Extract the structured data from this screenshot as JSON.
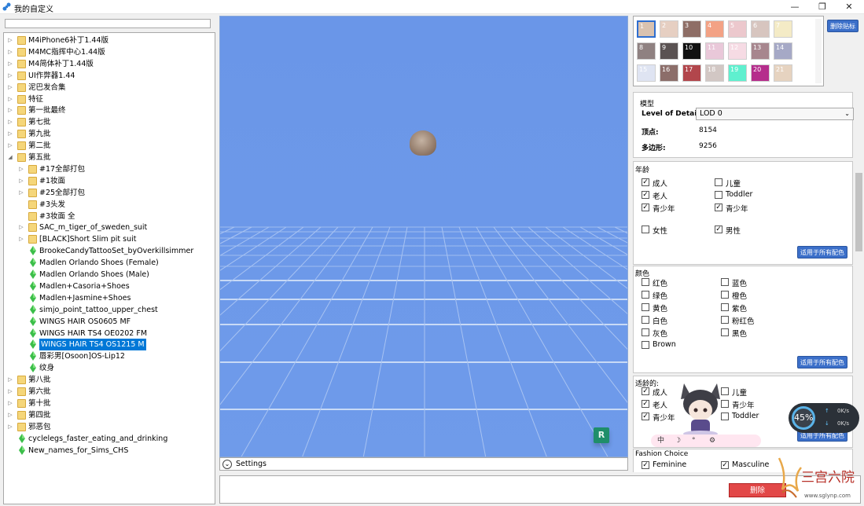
{
  "window": {
    "title": "我的自定义",
    "minimize": "—",
    "restore": "❐",
    "close": "✕"
  },
  "tree": {
    "items": [
      {
        "label": "M4iPhone6补丁1.44版",
        "kind": "folder",
        "level": 0,
        "expanded": false,
        "selected": false
      },
      {
        "label": "M4MC指挥中心1.44版",
        "kind": "folder",
        "level": 0,
        "expanded": false,
        "selected": false
      },
      {
        "label": "M4简体补丁1.44版",
        "kind": "folder",
        "level": 0,
        "expanded": false,
        "selected": false
      },
      {
        "label": "UI作弊器1.44",
        "kind": "folder",
        "level": 0,
        "expanded": false,
        "selected": false
      },
      {
        "label": "泥巴发合集",
        "kind": "folder",
        "level": 0,
        "expanded": false,
        "selected": false
      },
      {
        "label": "特征",
        "kind": "folder",
        "level": 0,
        "expanded": false,
        "selected": false
      },
      {
        "label": "第一批最终",
        "kind": "folder",
        "level": 0,
        "expanded": false,
        "selected": false
      },
      {
        "label": "第七批",
        "kind": "folder",
        "level": 0,
        "expanded": false,
        "selected": false
      },
      {
        "label": "第九批",
        "kind": "folder",
        "level": 0,
        "expanded": false,
        "selected": false
      },
      {
        "label": "第二批",
        "kind": "folder",
        "level": 0,
        "expanded": false,
        "selected": false
      },
      {
        "label": "第五批",
        "kind": "folder",
        "level": 0,
        "expanded": true,
        "selected": false
      },
      {
        "label": "#17全部打包",
        "kind": "folder",
        "level": 1,
        "expanded": false,
        "selected": false
      },
      {
        "label": "#1妆面",
        "kind": "folder",
        "level": 1,
        "expanded": false,
        "selected": false
      },
      {
        "label": "#25全部打包",
        "kind": "folder",
        "level": 1,
        "expanded": false,
        "selected": false
      },
      {
        "label": "#3头发",
        "kind": "folder",
        "level": 1,
        "expanded": null,
        "selected": false
      },
      {
        "label": "#3妆面 全",
        "kind": "folder",
        "level": 1,
        "expanded": null,
        "selected": false
      },
      {
        "label": "SAC_m_tiger_of_sweden_suit",
        "kind": "folder",
        "level": 1,
        "expanded": false,
        "selected": false
      },
      {
        "label": "[BLACK]Short Slim pit suit",
        "kind": "folder",
        "level": 1,
        "expanded": false,
        "selected": false
      },
      {
        "label": "BrookeCandyTattooSet_byOverkillsimmer",
        "kind": "item",
        "level": 1,
        "expanded": null,
        "selected": false
      },
      {
        "label": "Madlen Orlando Shoes (Female)",
        "kind": "item",
        "level": 1,
        "expanded": null,
        "selected": false
      },
      {
        "label": "Madlen Orlando Shoes (Male)",
        "kind": "item",
        "level": 1,
        "expanded": null,
        "selected": false
      },
      {
        "label": "Madlen+Casoria+Shoes",
        "kind": "item",
        "level": 1,
        "expanded": null,
        "selected": false
      },
      {
        "label": "Madlen+Jasmine+Shoes",
        "kind": "item",
        "level": 1,
        "expanded": null,
        "selected": false
      },
      {
        "label": "simjo_point_tattoo_upper_chest",
        "kind": "item",
        "level": 1,
        "expanded": null,
        "selected": false
      },
      {
        "label": "WINGS HAIR OS0605 MF",
        "kind": "item",
        "level": 1,
        "expanded": null,
        "selected": false
      },
      {
        "label": "WINGS HAIR TS4 OE0202 FM",
        "kind": "item",
        "level": 1,
        "expanded": null,
        "selected": false
      },
      {
        "label": "WINGS HAIR TS4 OS1215 M",
        "kind": "item",
        "level": 1,
        "expanded": null,
        "selected": true
      },
      {
        "label": "唇彩男[Osoon]OS-Lip12",
        "kind": "item",
        "level": 1,
        "expanded": null,
        "selected": false
      },
      {
        "label": "纹身",
        "kind": "item",
        "level": 1,
        "expanded": null,
        "selected": false
      },
      {
        "label": "第八批",
        "kind": "folder",
        "level": 0,
        "expanded": false,
        "selected": false
      },
      {
        "label": "第六批",
        "kind": "folder",
        "level": 0,
        "expanded": false,
        "selected": false
      },
      {
        "label": "第十批",
        "kind": "folder",
        "level": 0,
        "expanded": false,
        "selected": false
      },
      {
        "label": "第四批",
        "kind": "folder",
        "level": 0,
        "expanded": false,
        "selected": false
      },
      {
        "label": "邪恶包",
        "kind": "folder",
        "level": 0,
        "expanded": false,
        "selected": false
      },
      {
        "label": "cyclelegs_faster_eating_and_drinking",
        "kind": "item",
        "level": 0,
        "expanded": null,
        "selected": false
      },
      {
        "label": "New_names_for_Sims_CHS",
        "kind": "item",
        "level": 0,
        "expanded": null,
        "selected": false
      }
    ]
  },
  "viewport": {
    "settings_label": "Settings",
    "badge": "R"
  },
  "swatches": {
    "delete_label": "删除贴标",
    "items": [
      {
        "num": "1",
        "color": "#d9c2b0",
        "selected": true
      },
      {
        "num": "2",
        "color": "#e6cfc2",
        "selected": false
      },
      {
        "num": "3",
        "color": "#8e6e66",
        "selected": false
      },
      {
        "num": "4",
        "color": "#f3a285",
        "selected": false
      },
      {
        "num": "5",
        "color": "#ecc8cd",
        "selected": false
      },
      {
        "num": "6",
        "color": "#d7c5bf",
        "selected": false
      },
      {
        "num": "7",
        "color": "#f4ebc6",
        "selected": false
      },
      {
        "num": "8",
        "color": "#8f8181",
        "selected": false
      },
      {
        "num": "9",
        "color": "#5a5252",
        "selected": false
      },
      {
        "num": "10",
        "color": "#111111",
        "selected": false
      },
      {
        "num": "11",
        "color": "#e9c8d9",
        "selected": false
      },
      {
        "num": "12",
        "color": "#f6dbe4",
        "selected": false
      },
      {
        "num": "13",
        "color": "#a7868e",
        "selected": false
      },
      {
        "num": "14",
        "color": "#a6a9c6",
        "selected": false
      },
      {
        "num": "15",
        "color": "#dfe4f2",
        "selected": false
      },
      {
        "num": "16",
        "color": "#8c6e6a",
        "selected": false
      },
      {
        "num": "17",
        "color": "#b2464c",
        "selected": false
      },
      {
        "num": "18",
        "color": "#d2c7c4",
        "selected": false
      },
      {
        "num": "19",
        "color": "#5ff0cf",
        "selected": false
      },
      {
        "num": "20",
        "color": "#b52d8c",
        "selected": false
      },
      {
        "num": "21",
        "color": "#e6d3c0",
        "selected": false
      }
    ]
  },
  "model": {
    "title": "模型",
    "lod_label": "Level of Detail",
    "lod_value": "LOD 0",
    "vertices_label": "顶点:",
    "vertices_value": "8154",
    "polygons_label": "多边形:",
    "polygons_value": "9256"
  },
  "age": {
    "title": "年龄",
    "checks": [
      {
        "label": "成人",
        "checked": true
      },
      {
        "label": "儿童",
        "checked": false
      },
      {
        "label": "老人",
        "checked": true
      },
      {
        "label": "Toddler",
        "checked": false
      },
      {
        "label": "青少年",
        "checked": true
      },
      {
        "label": "青少年",
        "checked": true
      },
      {
        "label": "女性",
        "checked": false
      },
      {
        "label": "男性",
        "checked": true
      }
    ],
    "apply_label": "适用于所有配色"
  },
  "color": {
    "title": "颜色",
    "checks": [
      {
        "label": "红色",
        "checked": false
      },
      {
        "label": "蓝色",
        "checked": false
      },
      {
        "label": "绿色",
        "checked": false
      },
      {
        "label": "橙色",
        "checked": false
      },
      {
        "label": "黄色",
        "checked": false
      },
      {
        "label": "紫色",
        "checked": false
      },
      {
        "label": "白色",
        "checked": false
      },
      {
        "label": "粉红色",
        "checked": false
      },
      {
        "label": "灰色",
        "checked": false
      },
      {
        "label": "黑色",
        "checked": false
      },
      {
        "label": "Brown",
        "checked": false
      }
    ],
    "apply_label": "适用于所有配色"
  },
  "suitable_age": {
    "title": "适龄的:",
    "checks": [
      {
        "label": "成人",
        "checked": true
      },
      {
        "label": "儿童",
        "checked": false
      },
      {
        "label": "老人",
        "checked": true
      },
      {
        "label": "青少年",
        "checked": false
      },
      {
        "label": "青少年",
        "checked": true
      },
      {
        "label": "Toddler",
        "checked": false
      }
    ],
    "apply_label": "适用于所有配色"
  },
  "fashion": {
    "title": "Fashion Choice",
    "checks": [
      {
        "label": "Feminine",
        "checked": true
      },
      {
        "label": "Masculine",
        "checked": true
      }
    ]
  },
  "delete_button": "删除",
  "speed_widget": {
    "percent": "45%",
    "up": "0K/s",
    "down": "0K/s"
  },
  "mascot_toolbar": [
    "中",
    "☽",
    "°",
    "⚙"
  ]
}
